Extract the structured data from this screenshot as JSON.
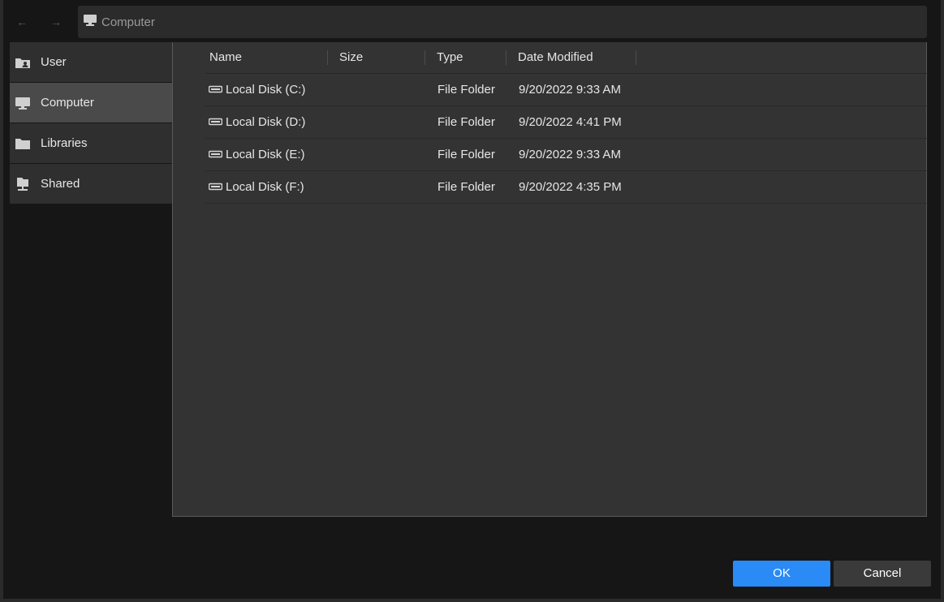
{
  "nav": {
    "back_glyph": "←",
    "forward_glyph": "→"
  },
  "address": {
    "icon": "computer-icon",
    "text": "Computer"
  },
  "sidebar": {
    "items": [
      {
        "label": "User",
        "icon": "user-folder-icon"
      },
      {
        "label": "Computer",
        "icon": "computer-icon",
        "active": true
      },
      {
        "label": "Libraries",
        "icon": "folder-icon"
      },
      {
        "label": "Shared",
        "icon": "shared-drive-icon"
      }
    ]
  },
  "table": {
    "columns": [
      "Name",
      "Size",
      "Type",
      "Date Modified"
    ],
    "rows": [
      {
        "name": "Local Disk (C:)",
        "size": "",
        "type": "File Folder",
        "modified": "9/20/2022 9:33 AM",
        "icon": "drive-icon"
      },
      {
        "name": "Local Disk (D:)",
        "size": "",
        "type": "File Folder",
        "modified": "9/20/2022 4:41 PM",
        "icon": "drive-icon"
      },
      {
        "name": "Local Disk (E:)",
        "size": "",
        "type": "File Folder",
        "modified": "9/20/2022 9:33 AM",
        "icon": "drive-icon"
      },
      {
        "name": "Local Disk (F:)",
        "size": "",
        "type": "File Folder",
        "modified": "9/20/2022 4:35 PM",
        "icon": "drive-icon"
      }
    ]
  },
  "buttons": {
    "ok": "OK",
    "cancel": "Cancel"
  },
  "colors": {
    "accent": "#2a8af6",
    "background": "#161616",
    "panel": "#333333",
    "active_item": "#4a4a4a"
  }
}
